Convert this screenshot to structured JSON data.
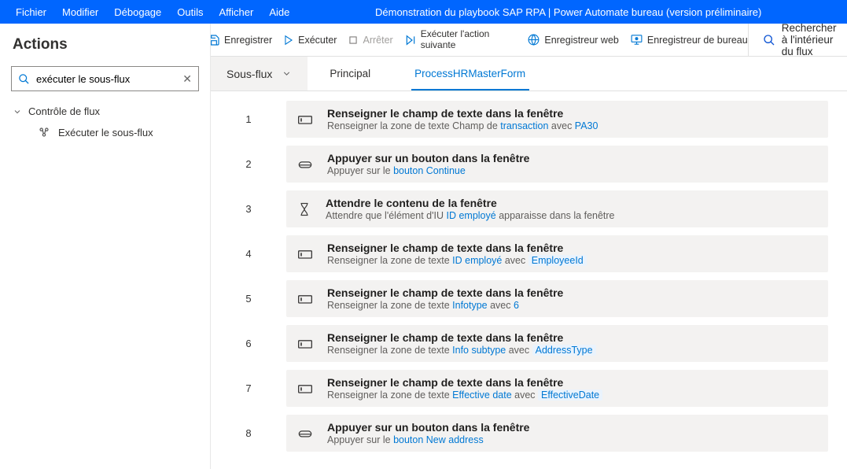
{
  "menu": {
    "items": [
      "Fichier",
      "Modifier",
      "Débogage",
      "Outils",
      "Afficher",
      "Aide"
    ],
    "title": "Démonstration du playbook SAP RPA | Power Automate bureau (version préliminaire)"
  },
  "toolbar": {
    "save": "Enregistrer",
    "run": "Exécuter",
    "stop": "Arrêter",
    "run_next_l1": "Exécuter l'action",
    "run_next_l2": "suivante",
    "recorder_web": "Enregistreur web",
    "recorder_desktop": "Enregistreur de bureau",
    "search_flow": "Rechercher à l'intérieur du flux"
  },
  "sidebar": {
    "title": "Actions",
    "search_value": "exécuter le sous-flux",
    "group": "Contrôle de flux",
    "item": "Exécuter le sous-flux"
  },
  "tabs": {
    "subflows": "Sous-flux",
    "main": "Principal",
    "process": "ProcessHRMasterForm"
  },
  "steps": [
    {
      "num": "1",
      "icon": "populate",
      "title": "Renseigner le champ de texte dans la fenêtre",
      "desc_pre": "Renseigner la zone de texte Champ de ",
      "link1": "transaction",
      "mid": " avec ",
      "link2": "PA30"
    },
    {
      "num": "2",
      "icon": "press",
      "title": "Appuyer sur un bouton dans la fenêtre",
      "desc_pre": "Appuyer sur le ",
      "link1": "bouton Continue",
      "mid": "",
      "link2": ""
    },
    {
      "num": "3",
      "icon": "wait",
      "title": "Attendre le contenu de la fenêtre",
      "desc_pre": "Attendre que l'élément d'IU ",
      "link1": "ID employé",
      "mid": " apparaisse dans la fenêtre",
      "link2": ""
    },
    {
      "num": "4",
      "icon": "populate",
      "title": "Renseigner le champ de texte dans la fenêtre",
      "desc_pre": "Renseigner la zone de texte ",
      "link1": "ID employé",
      "mid": " avec ",
      "var2": "EmployeeId"
    },
    {
      "num": "5",
      "icon": "populate",
      "title": "Renseigner le champ de texte dans la fenêtre",
      "desc_pre": "Renseigner la zone de texte ",
      "link1": "Infotype",
      "mid": " avec ",
      "link2": "6"
    },
    {
      "num": "6",
      "icon": "populate",
      "title": "Renseigner le champ de texte dans la fenêtre",
      "desc_pre": "Renseigner la zone de texte ",
      "link1": "Info subtype",
      "mid": " avec ",
      "var2": "AddressType"
    },
    {
      "num": "7",
      "icon": "populate",
      "title": "Renseigner le champ de texte dans la fenêtre",
      "desc_pre": "Renseigner la zone de texte ",
      "link1": "Effective date",
      "mid": " avec ",
      "var2": "EffectiveDate"
    },
    {
      "num": "8",
      "icon": "press",
      "title": "Appuyer sur un bouton dans la fenêtre",
      "desc_pre": "Appuyer sur le ",
      "link1": "bouton New address",
      "mid": "",
      "link2": ""
    }
  ]
}
